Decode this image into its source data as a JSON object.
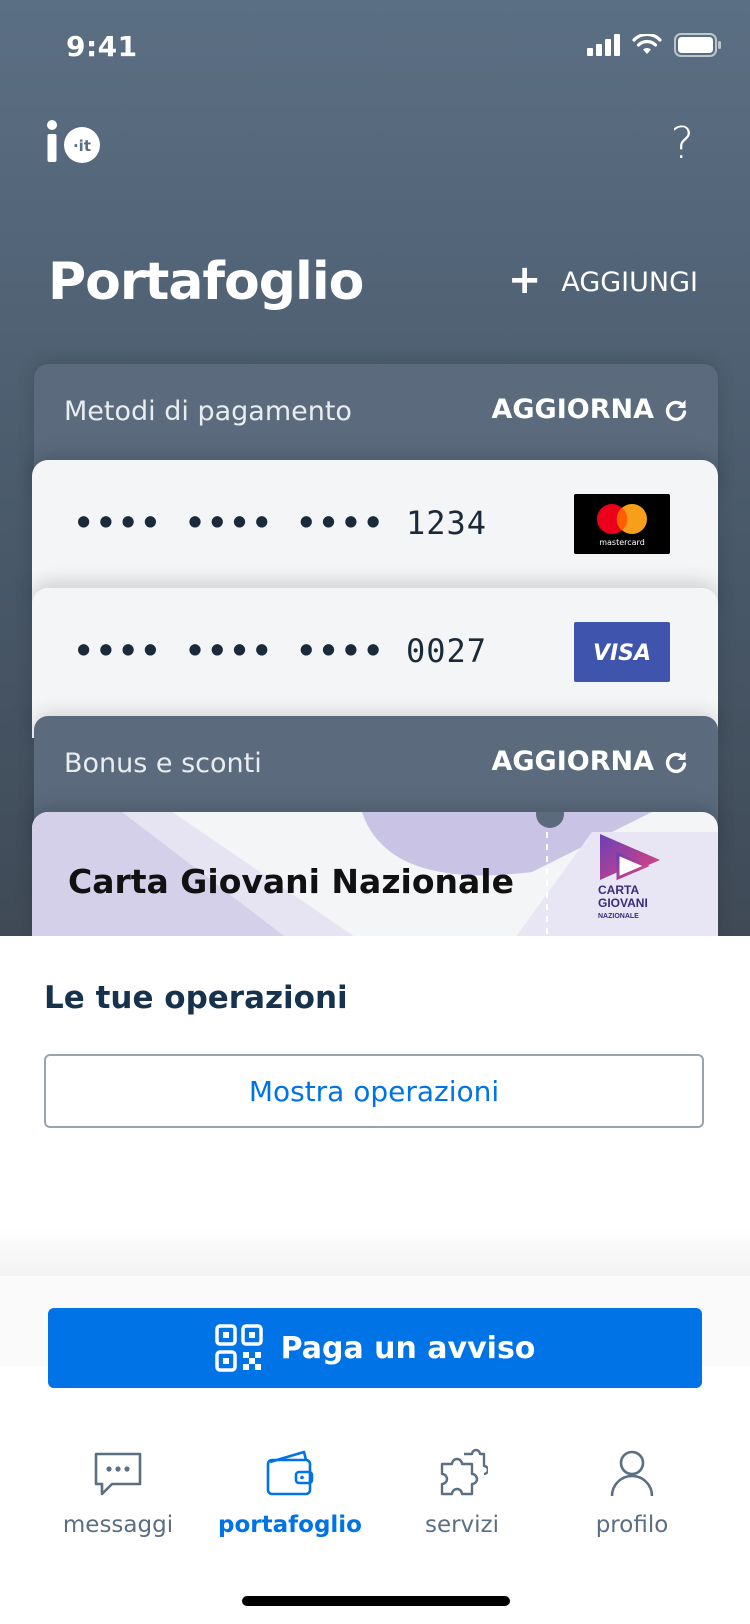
{
  "status_bar": {
    "time": "9:41"
  },
  "header": {
    "help_icon": "?",
    "logo_icon": "io-it-logo"
  },
  "page": {
    "title": "Portafoglio",
    "add_label": "AGGIUNGI",
    "add_icon": "+"
  },
  "payment_methods": {
    "title": "Metodi di pagamento",
    "refresh_label": "AGGIORNA",
    "cards": [
      {
        "masked": "•••• •••• ••••",
        "last4": "1234",
        "brand": "mastercard"
      },
      {
        "masked": "•••• •••• ••••",
        "last4": "0027",
        "brand": "VISA"
      }
    ]
  },
  "bonus": {
    "title": "Bonus e sconti",
    "refresh_label": "AGGIORNA",
    "card_title": "Carta Giovani Nazionale",
    "logo_lines": [
      "CARTA",
      "GIOVANI",
      "NAZIONALE"
    ]
  },
  "operations": {
    "title": "Le tue operazioni",
    "button_label": "Mostra operazioni"
  },
  "pay": {
    "label": "Paga un avviso"
  },
  "tabs": [
    {
      "label": "messaggi",
      "icon": "message-icon",
      "active": false
    },
    {
      "label": "portafoglio",
      "icon": "wallet-icon",
      "active": true
    },
    {
      "label": "servizi",
      "icon": "puzzle-icon",
      "active": false
    },
    {
      "label": "profilo",
      "icon": "person-icon",
      "active": false
    }
  ],
  "colors": {
    "accent": "#0073e6",
    "header_bg": "#5b6f84",
    "title_text": "#17324d"
  }
}
